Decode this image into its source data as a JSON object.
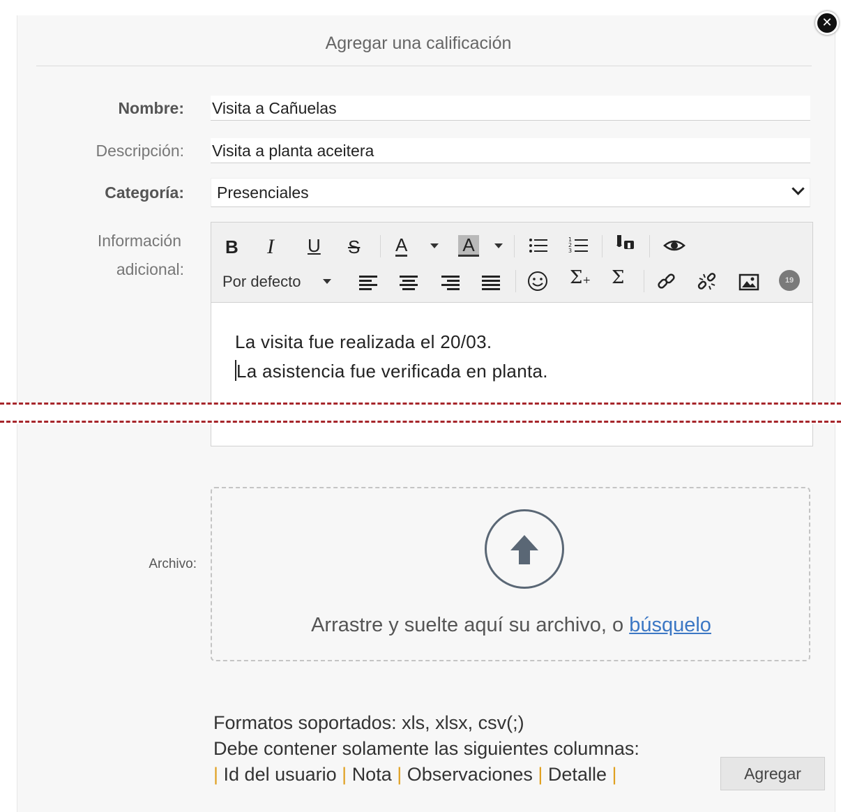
{
  "dialog": {
    "title": "Agregar una calificación",
    "close_symbol": "✕"
  },
  "form": {
    "nombre_label": "Nombre:",
    "nombre_value": "Visita a Cañuelas",
    "descripcion_label": "Descripción:",
    "descripcion_value": "Visita a planta aceitera",
    "categoria_label": "Categoría:",
    "categoria_value": "Presenciales",
    "info_label_line1": "Información",
    "info_label_line2": "adicional:",
    "archivo_label": "Archivo:"
  },
  "editor": {
    "toolbar": {
      "bold": "B",
      "italic": "I",
      "underline": "U",
      "strike": "S",
      "font_color": "A",
      "highlight": "A",
      "font_size": "Por defecto",
      "sigma_sub": "Σ",
      "sigma": "Σ",
      "special_chars": "19"
    },
    "content_line1": "La visita fue realizada el 20/03.",
    "content_line2": "La asistencia fue verificada en planta."
  },
  "dropzone": {
    "text": "Arrastre y suelte aquí su archivo, o ",
    "link": "búsquelo"
  },
  "notes": {
    "line1": "Formatos soportados: xls, xlsx, csv(;)",
    "line2": "Debe contener solamente las siguientes columnas:",
    "columns": [
      "Id del usuario",
      "Nota",
      "Observaciones",
      "Detalle"
    ]
  },
  "actions": {
    "submit": "Agregar"
  },
  "colors": {
    "link": "#3b77c4",
    "cut_line": "#a6262b",
    "pipe": "#e0a020"
  }
}
